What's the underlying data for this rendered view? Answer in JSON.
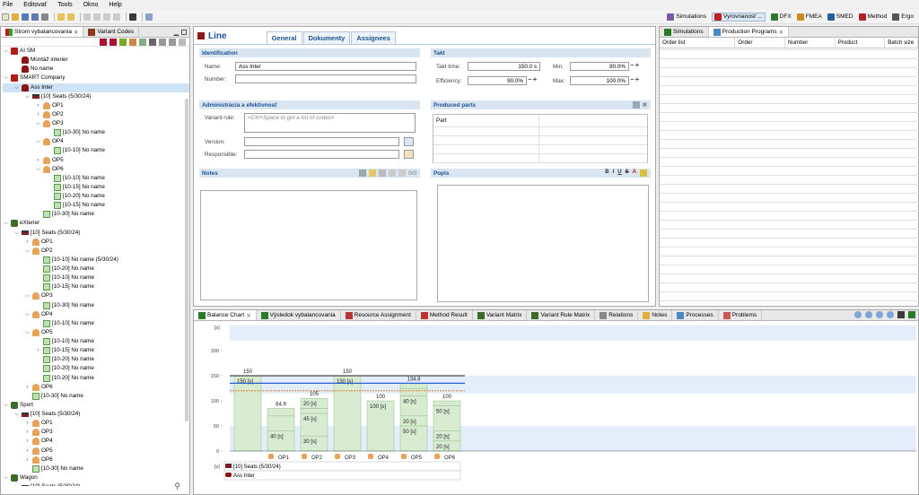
{
  "menu": [
    "File",
    "Editovať",
    "Tools",
    "Okno",
    "Help"
  ],
  "perspectives": [
    {
      "label": "Simulations",
      "color": "#7b5aa6"
    },
    {
      "label": "Vyrovnanosť ...",
      "color": "#c21f1f"
    },
    {
      "label": "DFX",
      "color": "#2c7a2c"
    },
    {
      "label": "FMEA",
      "color": "#c98b1d"
    },
    {
      "label": "SMED",
      "color": "#2d5fa0"
    },
    {
      "label": "Method",
      "color": "#b3212a"
    },
    {
      "label": "Ergo",
      "color": "#555"
    }
  ],
  "left": {
    "tabs": [
      "Strom vybalancovania",
      "Variant Codes"
    ],
    "tree": [
      {
        "d": 0,
        "tw": "⌵",
        "ic": "red",
        "t": "AI SM"
      },
      {
        "d": 1,
        "tw": "",
        "ic": "car",
        "t": "Montáž interier"
      },
      {
        "d": 1,
        "tw": "",
        "ic": "car",
        "t": "No name"
      },
      {
        "d": 0,
        "tw": "⌵",
        "ic": "red",
        "t": "SMART Company"
      },
      {
        "d": 1,
        "tw": "⌵",
        "ic": "car",
        "t": "Ass Inter",
        "sel": true
      },
      {
        "d": 2,
        "tw": "⌵",
        "ic": "line",
        "t": "[10] Seats (5/30/24)"
      },
      {
        "d": 3,
        "tw": "›",
        "ic": "op",
        "t": "OP1"
      },
      {
        "d": 3,
        "tw": "›",
        "ic": "op",
        "t": "OP2"
      },
      {
        "d": 3,
        "tw": "⌵",
        "ic": "op",
        "t": "OP3"
      },
      {
        "d": 4,
        "tw": "",
        "ic": "doc",
        "t": "[10-30] No name"
      },
      {
        "d": 3,
        "tw": "⌵",
        "ic": "op",
        "t": "OP4"
      },
      {
        "d": 4,
        "tw": "",
        "ic": "doc",
        "t": "[10-10] No name"
      },
      {
        "d": 3,
        "tw": "›",
        "ic": "op",
        "t": "OP5"
      },
      {
        "d": 3,
        "tw": "⌵",
        "ic": "op",
        "t": "OP6"
      },
      {
        "d": 4,
        "tw": "",
        "ic": "doc",
        "t": "[10-10] No name"
      },
      {
        "d": 4,
        "tw": "",
        "ic": "doc",
        "t": "[10-15] No name"
      },
      {
        "d": 4,
        "tw": "",
        "ic": "doc",
        "t": "[10-20] No name"
      },
      {
        "d": 4,
        "tw": "",
        "ic": "doc",
        "t": "[10-15] No name"
      },
      {
        "d": 3,
        "tw": "",
        "ic": "doc",
        "t": "[10-30] No name"
      },
      {
        "d": 0,
        "tw": "⌵",
        "ic": "green",
        "t": "eXterier"
      },
      {
        "d": 1,
        "tw": "⌵",
        "ic": "line",
        "t": "[10] Seats (5/30/24)"
      },
      {
        "d": 2,
        "tw": "›",
        "ic": "op",
        "t": "OP1"
      },
      {
        "d": 2,
        "tw": "⌵",
        "ic": "op",
        "t": "OP2"
      },
      {
        "d": 3,
        "tw": "",
        "ic": "doc",
        "t": "[10-10] No name (5/30/24)"
      },
      {
        "d": 3,
        "tw": "",
        "ic": "doc",
        "t": "[10-20] No name"
      },
      {
        "d": 3,
        "tw": "",
        "ic": "doc",
        "t": "[10-10] No name"
      },
      {
        "d": 3,
        "tw": "",
        "ic": "doc",
        "t": "[10-15] No name"
      },
      {
        "d": 2,
        "tw": "⌵",
        "ic": "op",
        "t": "OP3"
      },
      {
        "d": 3,
        "tw": "",
        "ic": "doc",
        "t": "[10-30] No name"
      },
      {
        "d": 2,
        "tw": "⌵",
        "ic": "op",
        "t": "OP4"
      },
      {
        "d": 3,
        "tw": "",
        "ic": "doc",
        "t": "[10-10] No name"
      },
      {
        "d": 2,
        "tw": "⌵",
        "ic": "op",
        "t": "OP5"
      },
      {
        "d": 3,
        "tw": "",
        "ic": "doc",
        "t": "[10-10] No name"
      },
      {
        "d": 3,
        "tw": "›",
        "ic": "doc",
        "t": "[10-15] No name"
      },
      {
        "d": 3,
        "tw": "",
        "ic": "doc",
        "t": "[10-20] No name"
      },
      {
        "d": 3,
        "tw": "",
        "ic": "doc",
        "t": "[10-20] No name"
      },
      {
        "d": 3,
        "tw": "",
        "ic": "doc",
        "t": "[10-20] No name"
      },
      {
        "d": 2,
        "tw": "›",
        "ic": "op",
        "t": "OP6"
      },
      {
        "d": 2,
        "tw": "",
        "ic": "doc",
        "t": "[10-30] No name"
      },
      {
        "d": 0,
        "tw": "⌵",
        "ic": "green",
        "t": "Sport"
      },
      {
        "d": 1,
        "tw": "⌵",
        "ic": "line",
        "t": "[10] Seats (5/30/24)"
      },
      {
        "d": 2,
        "tw": "›",
        "ic": "op",
        "t": "OP1"
      },
      {
        "d": 2,
        "tw": "›",
        "ic": "op",
        "t": "OP3"
      },
      {
        "d": 2,
        "tw": "›",
        "ic": "op",
        "t": "OP4"
      },
      {
        "d": 2,
        "tw": "›",
        "ic": "op",
        "t": "OP5"
      },
      {
        "d": 2,
        "tw": "›",
        "ic": "op",
        "t": "OP6"
      },
      {
        "d": 2,
        "tw": "",
        "ic": "doc",
        "t": "[10-30] No name"
      },
      {
        "d": 0,
        "tw": "⌵",
        "ic": "green",
        "t": "Wagon"
      },
      {
        "d": 1,
        "tw": "⌵",
        "ic": "line",
        "t": "[10] Seats (5/30/24)"
      }
    ]
  },
  "editor": {
    "title": "Line",
    "tabs": [
      "General",
      "Dokumenty",
      "Assignees"
    ],
    "identification": {
      "header": "Identification",
      "name_label": "Name:",
      "name_value": "Ass Inter",
      "number_label": "Number:",
      "number_value": ""
    },
    "admin": {
      "header": "Administrácia a efektivnosť",
      "variant_rule_label": "Variant rule:",
      "variant_rule_placeholder": "<Ctrl+Space to get a list of codes>",
      "version_label": "Version:",
      "responsible_label": "Responsible:"
    },
    "notes": {
      "header": "Notes",
      "counter": "0/0"
    },
    "takt": {
      "header": "Takt",
      "takt_time_label": "Takt time:",
      "takt_time_value": "150.0 s",
      "min_label": "Min:",
      "min_value": "80.0%",
      "efficiency_label": "Efficiency:",
      "efficiency_value": "90.0%",
      "max_label": "Max:",
      "max_value": "100.0%"
    },
    "produced": {
      "header": "Produced parts",
      "col": "Part"
    },
    "popis": {
      "header": "Popis",
      "fmt": [
        "B",
        "I",
        "U",
        "S",
        "A"
      ]
    }
  },
  "right": {
    "tabs": [
      "Simulations",
      "Production Programs"
    ],
    "columns": [
      "Order list",
      "Order",
      "Number",
      "Product",
      "Batch size"
    ]
  },
  "bottom": {
    "tabs": [
      "Balance Chart",
      "Výsledok vybalancovania",
      "Resource Assignment",
      "Method Result",
      "Variant Matrix",
      "Variant Rule Matrix",
      "Relations",
      "Notes",
      "Processes",
      "Problems"
    ],
    "row_labels": [
      "[10] Seats (5/30/24)",
      "Ass Inter"
    ],
    "unit_labels": [
      "[s]",
      "[s]"
    ]
  },
  "chart_data": {
    "type": "bar",
    "stacked": true,
    "categories": [
      "",
      "OP1",
      "OP2",
      "OP3",
      "OP4",
      "OP5",
      "OP6"
    ],
    "totals": [
      150,
      84.9,
      105,
      150,
      100,
      134.8,
      100
    ],
    "total_labels": [
      "150",
      "84.9",
      "105",
      "150",
      "100",
      "134.8",
      "100"
    ],
    "segments": [
      [
        150
      ],
      [
        40,
        30,
        14.9
      ],
      [
        30,
        45,
        10,
        20
      ],
      [
        150
      ],
      [
        100
      ],
      [
        50,
        20,
        40,
        14.8,
        10
      ],
      [
        20,
        20,
        50,
        10
      ]
    ],
    "segment_labels": [
      [
        "150 [s]"
      ],
      [
        "40 [s]",
        "",
        ""
      ],
      [
        "30 [s]",
        "45 [s]",
        "",
        "20 [s]"
      ],
      [
        "150 [s]"
      ],
      [
        "100 [s]"
      ],
      [
        "50 [s]",
        "20 [s]",
        "40 [s]",
        "",
        ""
      ],
      [
        "20 [s]",
        "20 [s]",
        "50 [s]",
        ""
      ]
    ],
    "yticks": [
      0,
      50,
      100,
      150,
      200
    ],
    "ylim": [
      0,
      250
    ],
    "y_top_label": "[s]",
    "takt_line": 150,
    "max_line": 150,
    "target_line": 135,
    "min_line": 120,
    "colors": {
      "bar": "#d7ecd1",
      "bar_border": "#8fbf87",
      "takt": "#1f1f1f",
      "target": "#2b5fd6",
      "min": "#e07020",
      "band": "#e3eefa"
    }
  }
}
